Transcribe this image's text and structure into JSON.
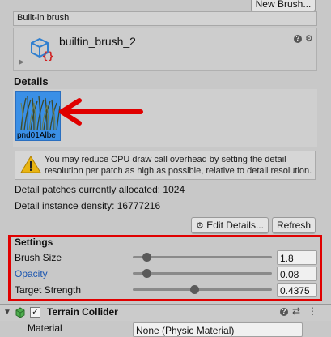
{
  "toolbar": {
    "new_brush_label": "New Brush..."
  },
  "brush_section": {
    "header": "Built-in brush",
    "brush_name": "builtin_brush_2"
  },
  "details": {
    "title": "Details",
    "thumbnail_caption": "pnd01Albe",
    "warning_text": "You may reduce CPU draw call overhead by setting the detail resolution per patch as high as possible, relative to detail resolution.",
    "patches_text": "Detail patches currently allocated: 1024",
    "density_text": "Detail instance density: 16777216",
    "edit_details_label": "Edit Details...",
    "refresh_label": "Refresh"
  },
  "settings": {
    "title": "Settings",
    "rows": [
      {
        "label": "Brush Size",
        "value": "1.8",
        "fraction": 0.02
      },
      {
        "label": "Opacity",
        "value": "0.08",
        "fraction": 0.08
      },
      {
        "label": "Target Strength",
        "value": "0.4375",
        "fraction": 0.4375
      }
    ]
  },
  "terrain_collider": {
    "title": "Terrain Collider",
    "material_label": "Material",
    "material_value": "None (Physic Material)"
  },
  "colors": {
    "highlight": "#e00000",
    "link_blue": "#1a55b0",
    "thumb_bg": "#3a8fe6"
  },
  "icons": [
    "help-icon",
    "settings-icon",
    "more-icon",
    "warning-icon",
    "brush-asset-icon",
    "collider-icon"
  ]
}
